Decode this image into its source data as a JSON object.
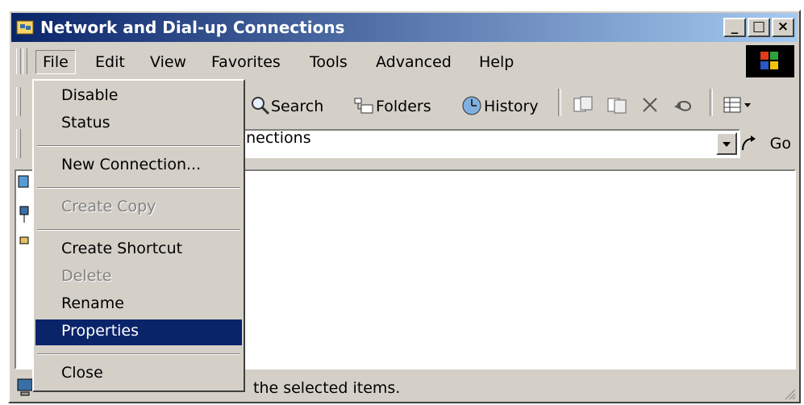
{
  "window": {
    "title": "Network and Dial-up Connections",
    "controls": {
      "minimize": "_",
      "maximize": "□",
      "close": "×"
    }
  },
  "menubar": {
    "items": [
      "File",
      "Edit",
      "View",
      "Favorites",
      "Tools",
      "Advanced",
      "Help"
    ]
  },
  "toolbar": {
    "search": "Search",
    "folders": "Folders",
    "history": "History"
  },
  "address": {
    "value": "Dial-up Connections",
    "visible_value": "ial-up Connections",
    "go": "Go"
  },
  "file_menu": {
    "items": [
      {
        "label": "Disable",
        "enabled": true
      },
      {
        "label": "Status",
        "enabled": true
      },
      {
        "label": "New Connection...",
        "enabled": true
      },
      {
        "label": "Create Copy",
        "enabled": false
      },
      {
        "label": "Create Shortcut",
        "enabled": true
      },
      {
        "label": "Delete",
        "enabled": false
      },
      {
        "label": "Rename",
        "enabled": true
      },
      {
        "label": "Properties",
        "enabled": true,
        "highlighted": true
      },
      {
        "label": "Close",
        "enabled": true
      }
    ]
  },
  "statusbar": {
    "text": "the selected items."
  },
  "colors": {
    "title_start": "#0a246a",
    "title_end": "#a6caf0",
    "highlight": "#0a246a",
    "face": "#d4d0c8"
  }
}
